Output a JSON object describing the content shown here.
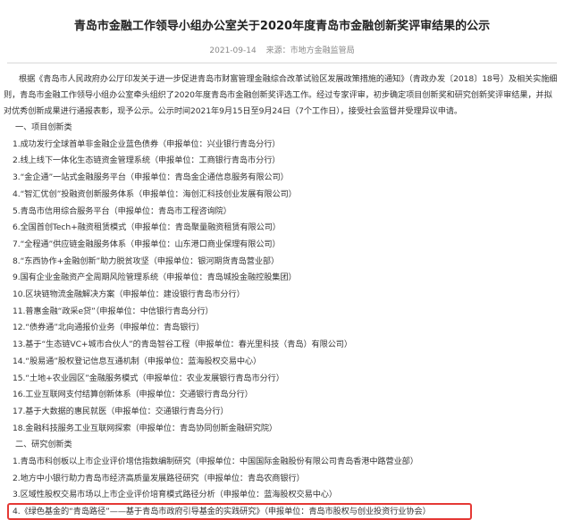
{
  "title": "青岛市金融工作领导小组办公室关于2020年度青岛市金融创新奖评审结果的公示",
  "meta": {
    "date": "2021-09-14",
    "source_label": "来源：",
    "source": "市地方金融监管局"
  },
  "intro": "根据《青岛市人民政府办公厅印发关于进一步促进青岛市财富管理金融综合改革试验区发展政策措施的通知》（青政办发〔2018〕18号）及相关实施细则，青岛市金融工作领导小组办公室牵头组织了2020年度青岛市金融创新奖评选工作。经过专家评审，初步确定项目创新奖和研究创新奖评审结果，并拟对优秀创新成果进行通报表彰，现予公示。公示时间2021年9月15日至9月24日（7个工作日），接受社会监督并受理异议申请。",
  "sections": [
    {
      "heading": "一、项目创新类",
      "items": [
        "1.成功发行全球首单非金融企业蓝色债券（申报单位：兴业银行青岛分行）",
        "2.线上线下一体化生态链资金管理系统（申报单位：工商银行青岛市分行）",
        "3.“金企通”一站式金融服务平台（申报单位：青岛金企通信息服务有限公司）",
        "4.“智汇优创”投融资创新服务体系（申报单位：海创汇科技创业发展有限公司）",
        "5.青岛市信用综合服务平台（申报单位：青岛市工程咨询院）",
        "6.全国首创Tech+融资租赁模式（申报单位：青岛聚量融资租赁有限公司）",
        "7.“全程通”供应链金融服务体系（申报单位：山东港口商业保理有限公司）",
        "8.“东西协作+金融创新”助力脱贫攻坚（申报单位：银河期货青岛营业部）",
        "9.国有企业金融资产全周期风险管理系统（申报单位：青岛城投金融控股集团）",
        "10.区块链物流金融解决方案（申报单位：建设银行青岛市分行）",
        "11.普惠金融“政采e贷”（申报单位：中信银行青岛分行）",
        "12.“债券通”北向通报价业务（申报单位：青岛银行）",
        "13.基于“生态链VC+城市合伙人”的青岛智谷工程（申报单位：春光里科技（青岛）有限公司）",
        "14.“股易通”股权登记信息互通机制（申报单位：蓝海股权交易中心）",
        "15.“土地+农业园区”金融服务模式（申报单位：农业发展银行青岛市分行）",
        "16.工业互联网支付结算创新体系（申报单位：交通银行青岛分行）",
        "17.基于大数据的惠民就医（申报单位：交通银行青岛分行）",
        "18.金融科技服务工业互联网探索（申报单位：青岛协同创新金融研究院）"
      ]
    },
    {
      "heading": "二、研究创新类",
      "items": [
        "1.青岛市科创板以上市企业评价增信指数编制研究（申报单位：中国国际金融股份有限公司青岛香港中路营业部）",
        "2.地方中小银行助力青岛市经济高质量发展路径研究（申报单位：青岛农商银行）",
        "3.区域性股权交易市场以上市企业评价培育模式路径分析（申报单位：蓝海股权交易中心）",
        "4.《绿色基金的“青岛路径”——基于青岛市政府引导基金的实践研究》（申报单位：青岛市股权与创业投资行业协会）"
      ]
    }
  ]
}
